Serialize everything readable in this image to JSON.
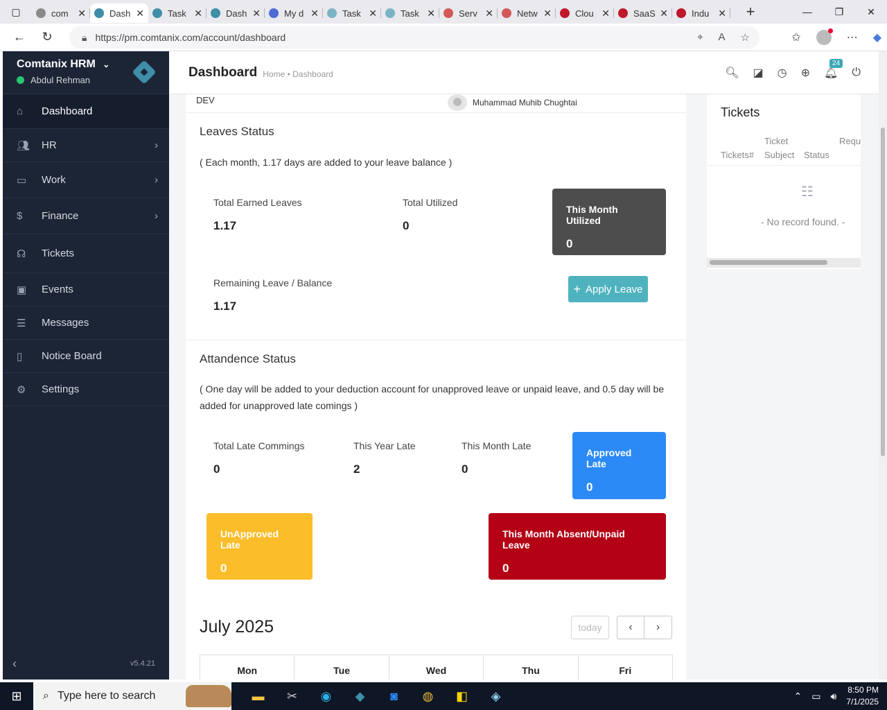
{
  "browser": {
    "tabs": [
      {
        "label": "com",
        "color": "#8a8a8a",
        "active": false
      },
      {
        "label": "Dash",
        "color": "#3d8ea6",
        "active": true
      },
      {
        "label": "Task",
        "color": "#3d8ea6",
        "active": false
      },
      {
        "label": "Dash",
        "color": "#3d8ea6",
        "active": false
      },
      {
        "label": "My d",
        "color": "#4f6bd6",
        "active": false
      },
      {
        "label": "Task",
        "color": "#7ab4c4",
        "active": false
      },
      {
        "label": "Task",
        "color": "#7ab4c4",
        "active": false
      },
      {
        "label": "Serv",
        "color": "#d35858",
        "active": false
      },
      {
        "label": "Netw",
        "color": "#d35858",
        "active": false
      },
      {
        "label": "Clou",
        "color": "#c0182b",
        "active": false
      },
      {
        "label": "SaaS",
        "color": "#c0182b",
        "active": false
      },
      {
        "label": "Indu",
        "color": "#c0182b",
        "active": false
      }
    ],
    "url": "https://pm.comtanix.com/account/dashboard"
  },
  "sidebar": {
    "app_name": "Comtanix HRM",
    "user_name": "Abdul Rehman",
    "version": "v5.4.21",
    "items": [
      {
        "label": "Dashboard",
        "icon": "home-icon"
      },
      {
        "label": "HR",
        "icon": "users-icon"
      },
      {
        "label": "Work",
        "icon": "briefcase-icon"
      },
      {
        "label": "Finance",
        "icon": "dollar-icon"
      },
      {
        "label": "Tickets",
        "icon": "headset-icon"
      },
      {
        "label": "Events",
        "icon": "calendar-icon"
      },
      {
        "label": "Messages",
        "icon": "message-icon"
      },
      {
        "label": "Notice Board",
        "icon": "clipboard-icon"
      },
      {
        "label": "Settings",
        "icon": "gear-icon"
      }
    ]
  },
  "topbar": {
    "title": "Dashboard",
    "breadcrumb": "Home • Dashboard",
    "notification_count": "24"
  },
  "profile_row": {
    "dept": "DEV",
    "person": "Muhammad Muhib Chughtai"
  },
  "leaves": {
    "title": "Leaves Status",
    "note": "( Each month, 1.17 days are added to your leave balance )",
    "earned_label": "Total Earned Leaves",
    "earned_value": "1.17",
    "utilized_label": "Total Utilized",
    "utilized_value": "0",
    "month_utilized_label": "This Month Utilized",
    "month_utilized_value": "0",
    "remaining_label": "Remaining Leave / Balance",
    "remaining_value": "1.17",
    "apply_label": "Apply Leave"
  },
  "attendance": {
    "title": "Attandence Status",
    "note_line1": "( One day will be added to your deduction account for unapproved leave or unpaid leave, and 0.5 day will be",
    "note_line2": "added for unapproved late comings )",
    "total_late_label": "Total Late Commings",
    "total_late_value": "0",
    "year_late_label": "This Year Late",
    "year_late_value": "2",
    "month_late_label": "This Month Late",
    "month_late_value": "0",
    "approved_label": "Approved Late",
    "approved_value": "0",
    "unapproved_label": "UnApproved Late",
    "unapproved_value": "0",
    "absent_label": "This Month Absent/Unpaid Leave",
    "absent_value": "0"
  },
  "calendar": {
    "month": "July 2025",
    "today_label": "today",
    "days": [
      "Mon",
      "Tue",
      "Wed",
      "Thu",
      "Fri"
    ]
  },
  "tickets": {
    "title": "Tickets",
    "col_number": "Tickets#",
    "col_subject_1": "Ticket",
    "col_subject_2": "Subject",
    "col_status": "Status",
    "col_requester": "Requ",
    "empty": "- No record found. -"
  },
  "taskbar": {
    "search_placeholder": "Type here to search",
    "time": "8:50 PM",
    "date": "7/1/2025"
  },
  "colors": {
    "sidebar_bg": "#1c2536",
    "month_utilized_bg": "#4d4d4d",
    "apply_bg": "#4fb3bf",
    "approved_bg": "#2b8af5",
    "unapproved_bg": "#fbbd2a",
    "absent_bg": "#b40115"
  }
}
